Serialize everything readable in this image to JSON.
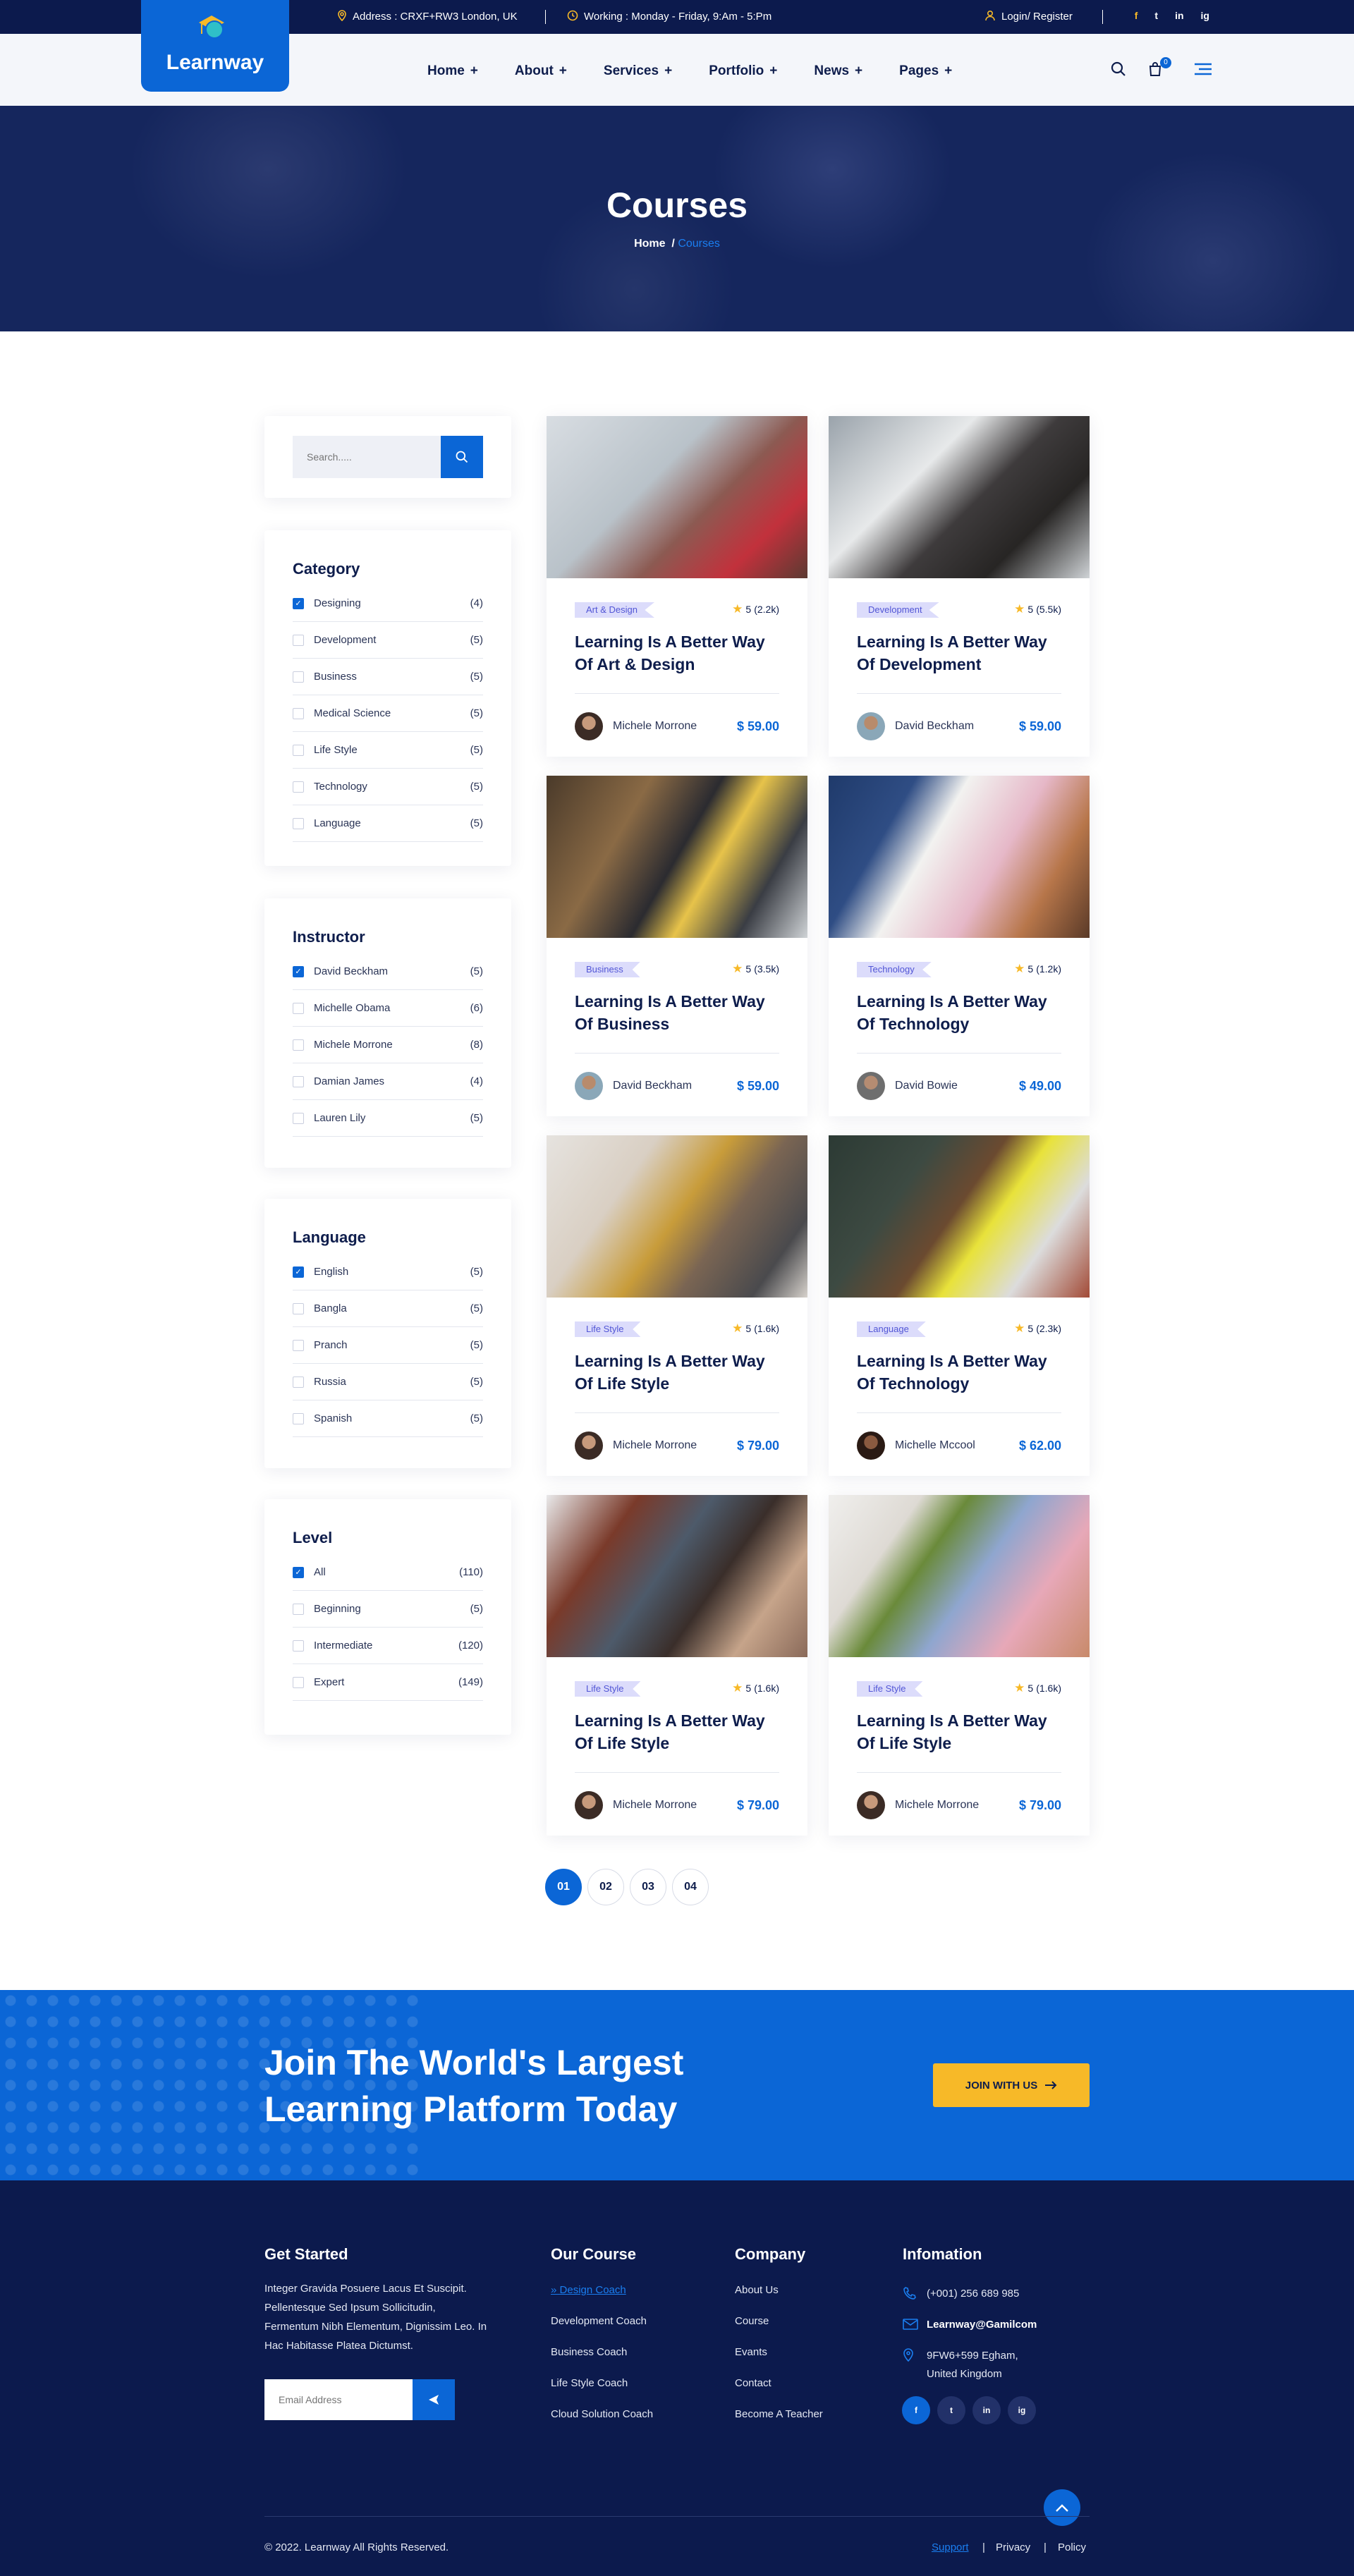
{
  "topbar": {
    "address": "Address : CRXF+RW3 London, UK",
    "working": "Working : Monday - Friday, 9:Am - 5:Pm",
    "login": "Login/ Register",
    "social": [
      "f",
      "t",
      "in",
      "ig"
    ]
  },
  "header": {
    "logo_text": "Learnway",
    "nav": [
      {
        "label": "Home",
        "plus": "+"
      },
      {
        "label": "About",
        "plus": "+"
      },
      {
        "label": "Services",
        "plus": "+"
      },
      {
        "label": "Portfolio",
        "plus": "+"
      },
      {
        "label": "News",
        "plus": "+"
      },
      {
        "label": "Pages",
        "plus": "+"
      }
    ],
    "cart_count": "0"
  },
  "hero": {
    "title": "Courses",
    "crumb_home": "Home",
    "crumb_sep": "/",
    "crumb_current": "Courses"
  },
  "sidebar": {
    "search_placeholder": "Search.....",
    "category": {
      "title": "Category",
      "items": [
        {
          "label": "Designing",
          "count": "(4)",
          "checked": true
        },
        {
          "label": "Development",
          "count": "(5)",
          "checked": false
        },
        {
          "label": "Business",
          "count": "(5)",
          "checked": false
        },
        {
          "label": "Medical Science",
          "count": "(5)",
          "checked": false
        },
        {
          "label": "Life Style",
          "count": "(5)",
          "checked": false
        },
        {
          "label": "Technology",
          "count": "(5)",
          "checked": false
        },
        {
          "label": "Language",
          "count": "(5)",
          "checked": false
        }
      ]
    },
    "instructor": {
      "title": "Instructor",
      "items": [
        {
          "label": "David Beckham",
          "count": "(5)",
          "checked": true
        },
        {
          "label": "Michelle Obama",
          "count": "(6)",
          "checked": false
        },
        {
          "label": "Michele Morrone",
          "count": "(8)",
          "checked": false
        },
        {
          "label": "Damian James",
          "count": "(4)",
          "checked": false
        },
        {
          "label": "Lauren Lily",
          "count": "(5)",
          "checked": false
        }
      ]
    },
    "language": {
      "title": "Language",
      "items": [
        {
          "label": "English",
          "count": "(5)",
          "checked": true
        },
        {
          "label": "Bangla",
          "count": "(5)",
          "checked": false
        },
        {
          "label": "Pranch",
          "count": "(5)",
          "checked": false
        },
        {
          "label": "Russia",
          "count": "(5)",
          "checked": false
        },
        {
          "label": "Spanish",
          "count": "(5)",
          "checked": false
        }
      ]
    },
    "level": {
      "title": "Level",
      "items": [
        {
          "label": "All",
          "count": "(110)",
          "checked": true
        },
        {
          "label": "Beginning",
          "count": "(5)",
          "checked": false
        },
        {
          "label": "Intermediate",
          "count": "(120)",
          "checked": false
        },
        {
          "label": "Expert",
          "count": "(149)",
          "checked": false
        }
      ]
    }
  },
  "courses": [
    {
      "tag": "Art & Design",
      "rating": "5",
      "reviews": "(2.2k)",
      "title": "Learning Is A Better Way Of Art & Design",
      "author": "Michele Morrone",
      "price": "$ 59.00"
    },
    {
      "tag": "Development",
      "rating": "5",
      "reviews": "(5.5k)",
      "title": "Learning Is A Better Way Of Development",
      "author": "David Beckham",
      "price": "$ 59.00"
    },
    {
      "tag": "Business",
      "rating": "5",
      "reviews": "(3.5k)",
      "title": "Learning Is A Better Way Of Business",
      "author": "David Beckham",
      "price": "$ 59.00"
    },
    {
      "tag": "Technology",
      "rating": "5",
      "reviews": "(1.2k)",
      "title": "Learning Is A Better Way Of Technology",
      "author": "David Bowie",
      "price": "$ 49.00"
    },
    {
      "tag": "Life Style",
      "rating": "5",
      "reviews": "(1.6k)",
      "title": "Learning Is A Better Way Of Life Style",
      "author": "Michele Morrone",
      "price": "$ 79.00"
    },
    {
      "tag": "Language",
      "rating": "5",
      "reviews": "(2.3k)",
      "title": "Learning Is A Better Way Of Technology",
      "author": "Michelle Mccool",
      "price": "$ 62.00"
    },
    {
      "tag": "Life Style",
      "rating": "5",
      "reviews": "(1.6k)",
      "title": "Learning Is A Better Way Of Life Style",
      "author": "Michele Morrone",
      "price": "$ 79.00"
    },
    {
      "tag": "Life Style",
      "rating": "5",
      "reviews": "(1.6k)",
      "title": "Learning Is A Better Way Of Life Style",
      "author": "Michele Morrone",
      "price": "$ 79.00"
    }
  ],
  "pagination": [
    "01",
    "02",
    "03",
    "04"
  ],
  "cta": {
    "title": "Join The World's Largest Learning Platform Today",
    "button": "JOIN WITH US"
  },
  "footer": {
    "get_started": {
      "title": "Get Started",
      "text": "Integer Gravida Posuere Lacus Et Suscipit. Pellentesque Sed Ipsum Sollicitudin, Fermentum Nibh Elementum, Dignissim Leo. In Hac Habitasse Platea Dictumst.",
      "email_placeholder": "Email Address"
    },
    "our_course": {
      "title": "Our Course",
      "links": [
        "Design Coach",
        "Development Coach",
        "Business Coach",
        "Life Style Coach",
        "Cloud Solution Coach"
      ]
    },
    "company": {
      "title": "Company",
      "links": [
        "About Us",
        "Course",
        "Evants",
        "Contact",
        "Become A Teacher"
      ]
    },
    "info": {
      "title": "Infomation",
      "phone": "(+001) 256 689 985",
      "email": "Learnway@Gamilcom",
      "address_line1": "9FW6+599 Egham,",
      "address_line2": "United Kingdom",
      "social": [
        "f",
        "t",
        "in",
        "ig"
      ]
    },
    "copyright": "© 2022.  Learnway All Rights Reserved.",
    "bottom_links": [
      "Support",
      "Privacy",
      "Policy"
    ],
    "sep": "|"
  },
  "colors": {
    "primary": "#0b66d6",
    "navy": "#0c1a4d",
    "accent": "#f7b928"
  }
}
